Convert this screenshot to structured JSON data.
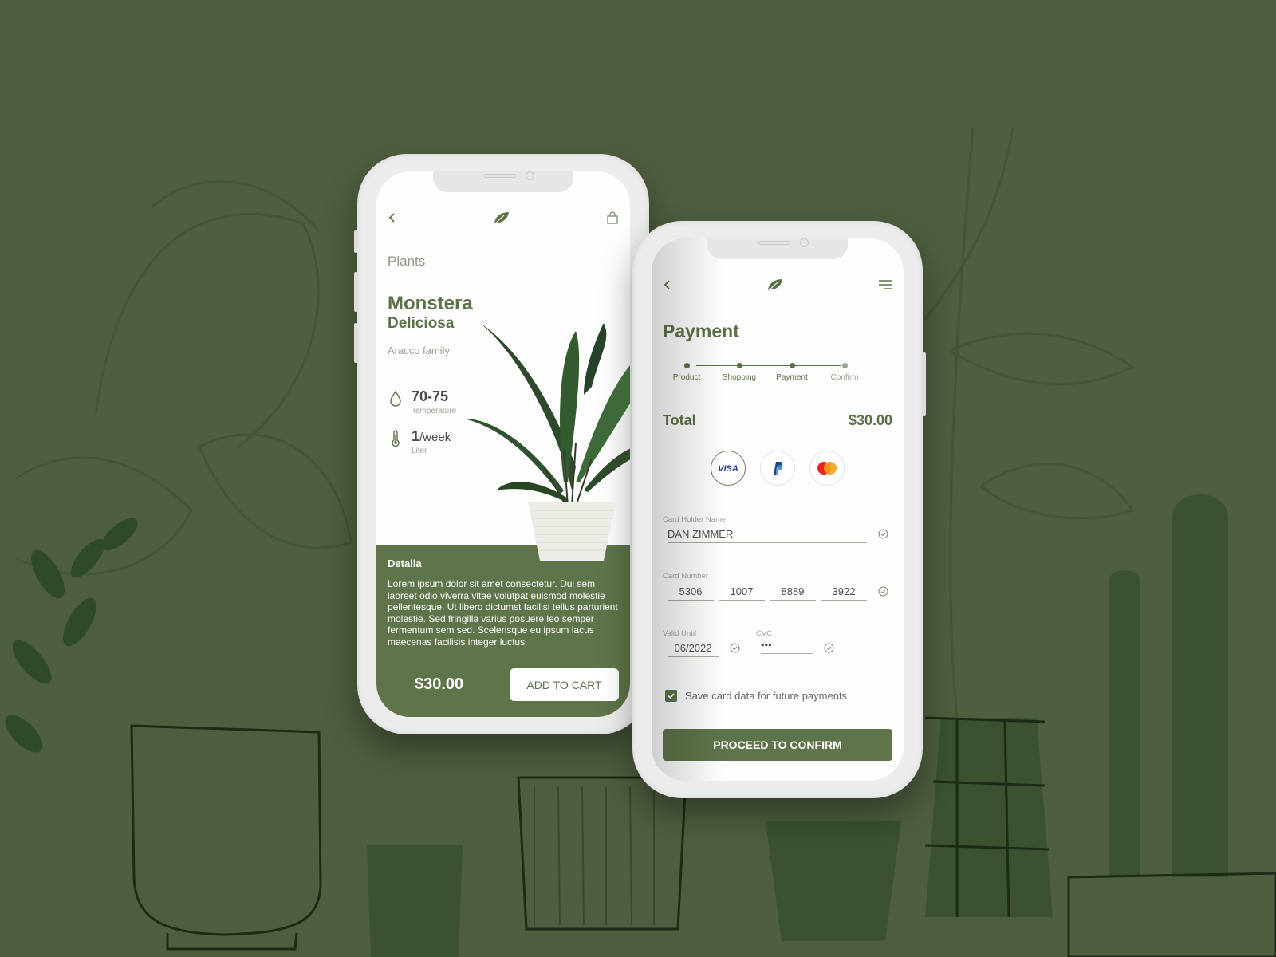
{
  "colors": {
    "background": "#4e5e3e",
    "accent": "#5d7148",
    "panel": "#5f744a"
  },
  "product_screen": {
    "nav": {
      "back_icon": "chevron-left-icon",
      "logo_icon": "leaf-icon",
      "cart_icon": "shopping-bag-icon"
    },
    "category": "Plants",
    "name_line1": "Monstera",
    "name_line2": "Deliciosa",
    "family": "Aracco family",
    "stats": [
      {
        "icon": "water-drop-icon",
        "value": "70-75",
        "unit": "",
        "label": "Temperature"
      },
      {
        "icon": "thermometer-icon",
        "value": "1",
        "unit": "/week",
        "label": "Liter"
      }
    ],
    "details": {
      "title": "Detaila",
      "body": "Lorem ipsum dolor sit amet consectetur. Dui sem laoreet odio viverra vitae volutpat euismod molestie pellentesque. Ut libero dictumst facilisi tellus parturient molestie. Sed fringilla varius posuere leo semper fermentum sem sed. Scelerisque eu ipsum lacus maecenas facilisis integer luctus."
    },
    "price": "$30.00",
    "add_to_cart_label": "ADD TO CART"
  },
  "payment_screen": {
    "nav": {
      "back_icon": "chevron-left-icon",
      "logo_icon": "leaf-icon",
      "menu_icon": "menu-icon"
    },
    "title": "Payment",
    "steps": [
      {
        "label": "Product",
        "active": true
      },
      {
        "label": "Shopping",
        "active": true
      },
      {
        "label": "Payment",
        "active": true
      },
      {
        "label": "Confirm",
        "active": false
      }
    ],
    "total_label": "Total",
    "total_value": "$30.00",
    "payment_methods": [
      {
        "name": "VISA",
        "selected": true
      },
      {
        "name": "PayPal",
        "selected": false
      },
      {
        "name": "Mastercard",
        "selected": false
      }
    ],
    "card_holder": {
      "label": "Card Holder Name",
      "value": "DAN ZIMMER"
    },
    "card_number": {
      "label": "Card Number",
      "groups": [
        "5306",
        "1007",
        "8889",
        "3922"
      ]
    },
    "valid_until": {
      "label": "Valid Until",
      "value": "06/2022"
    },
    "cvc": {
      "label": "CVC",
      "value": "•••"
    },
    "save_card": {
      "checked": true,
      "label": "Save card  data for future payments"
    },
    "proceed_label": "PROCEED TO CONFIRM"
  }
}
